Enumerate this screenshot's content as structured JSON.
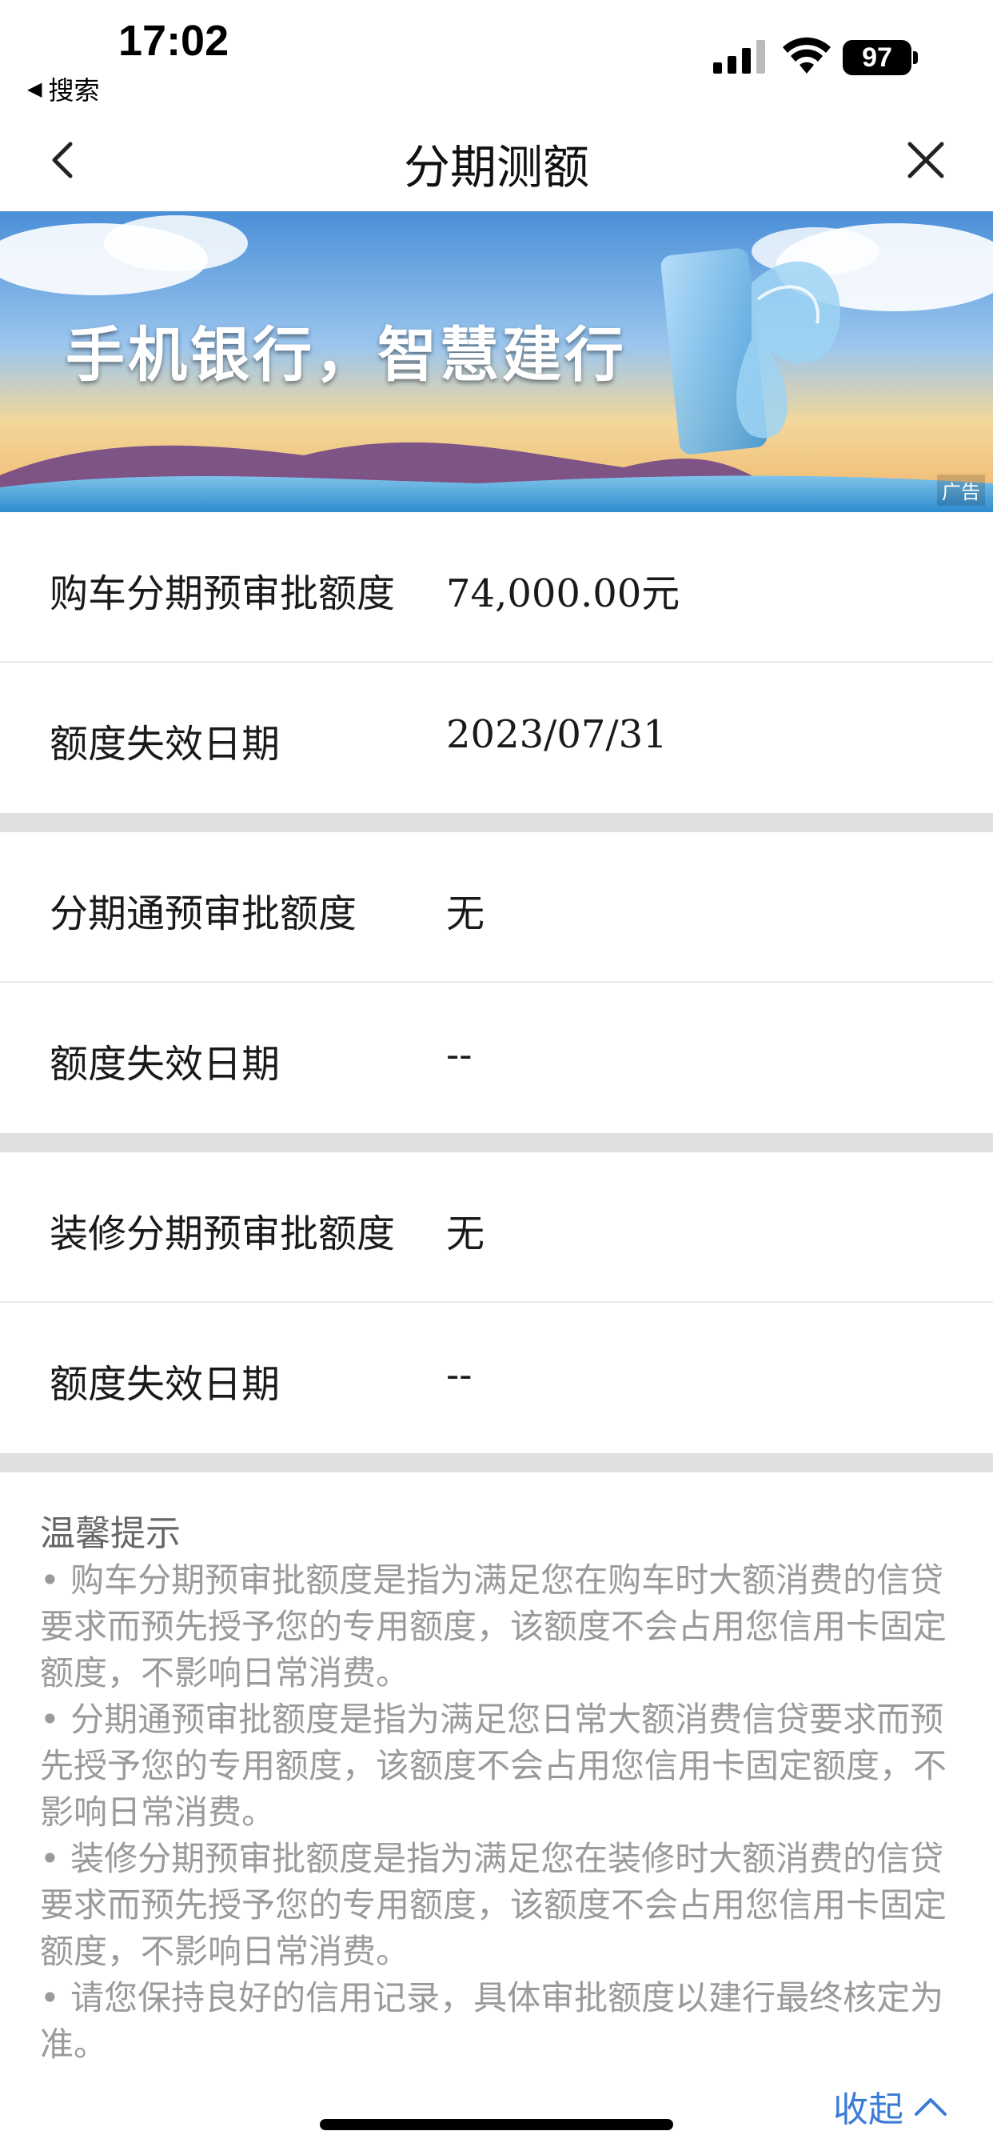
{
  "status_bar": {
    "time": "17:02",
    "back_app_label": "搜索",
    "battery_level": "97",
    "icons": [
      "signal-icon",
      "wifi-icon",
      "battery-icon"
    ]
  },
  "nav": {
    "title": "分期测额",
    "back_icon": "chevron-left-icon",
    "close_icon": "close-icon"
  },
  "banner": {
    "slogan": "手机银行，智慧建行",
    "ad_label": "广告"
  },
  "groups": [
    {
      "rows": [
        {
          "label": "购车分期预审批额度",
          "value": "74,000.00元"
        },
        {
          "label": "额度失效日期",
          "value": "2023/07/31"
        }
      ]
    },
    {
      "rows": [
        {
          "label": "分期通预审批额度",
          "value": "无"
        },
        {
          "label": "额度失效日期",
          "value": "--"
        }
      ]
    },
    {
      "rows": [
        {
          "label": "装修分期预审批额度",
          "value": "无"
        },
        {
          "label": "额度失效日期",
          "value": "--"
        }
      ]
    }
  ],
  "tips": {
    "title": "温馨提示",
    "items": [
      "• 购车分期预审批额度是指为满足您在购车时大额消费的信贷要求而预先授予您的专用额度，该额度不会占用您信用卡固定额度，不影响日常消费。",
      "• 分期通预审批额度是指为满足您日常大额消费信贷要求而预先授予您的专用额度，该额度不会占用您信用卡固定额度，不影响日常消费。",
      "• 装修分期预审批额度是指为满足您在装修时大额消费的信贷要求而预先授予您的专用额度，该额度不会占用您信用卡固定额度，不影响日常消费。",
      "• 请您保持良好的信用记录，具体审批额度以建行最终核定为准。"
    ],
    "collapse_label": "收起"
  },
  "colors": {
    "accent": "#3a7bd5",
    "divider": "#e0e0e0",
    "tip_text": "#9a9a9a"
  }
}
